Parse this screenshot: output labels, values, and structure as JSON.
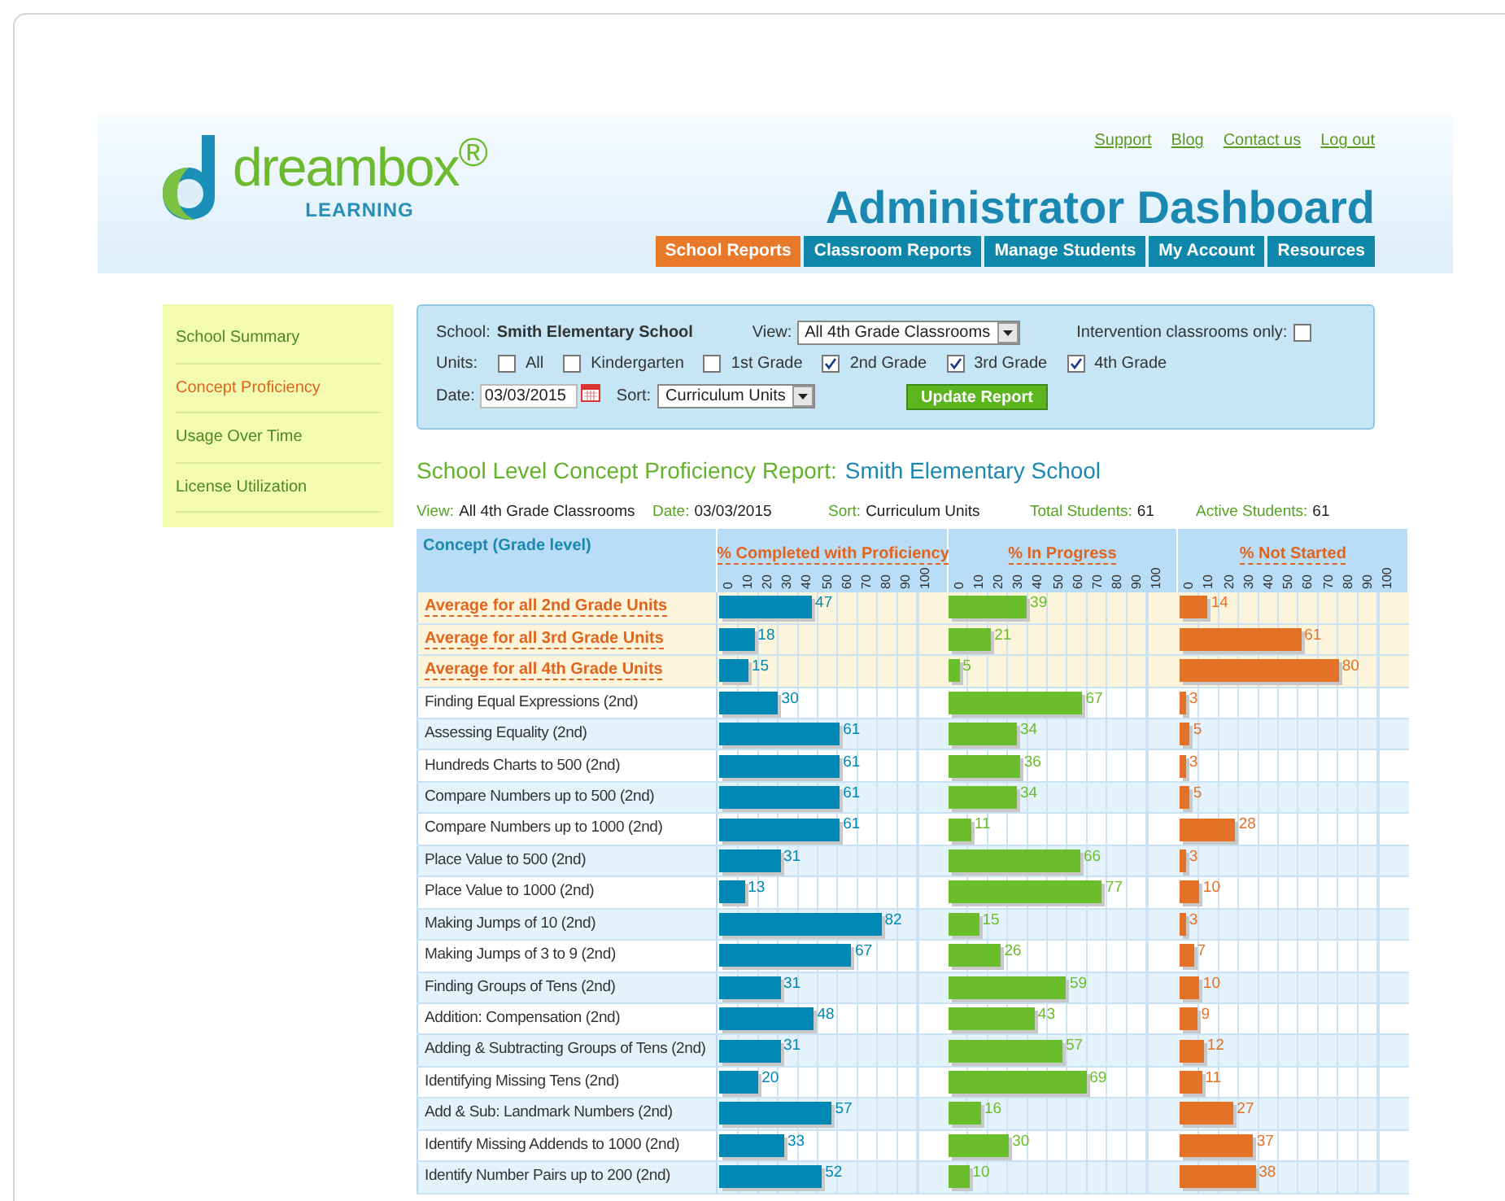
{
  "top_links": [
    "Support",
    "Blog",
    "Contact us",
    "Log out"
  ],
  "logo": {
    "name": "dreambox$^{®}$",
    "tagline": "LEARNING"
  },
  "page_title": "Administrator Dashboard",
  "tabs": [
    {
      "label": "School Reports",
      "selected": true
    },
    {
      "label": "Classroom Reports",
      "selected": false
    },
    {
      "label": "Manage Students",
      "selected": false
    },
    {
      "label": "My Account",
      "selected": false
    },
    {
      "label": "Resources",
      "selected": false
    }
  ],
  "sidebar": {
    "items": [
      {
        "label": "School Summary",
        "selected": false
      },
      {
        "label": "Concept Proficiency",
        "selected": true
      },
      {
        "label": "Usage Over Time",
        "selected": false
      },
      {
        "label": "License Utilization",
        "selected": false
      }
    ]
  },
  "filters": {
    "school_label": "School:",
    "school": "Smith Elementary School",
    "view_label": "View:",
    "view": "All 4th Grade Classrooms",
    "intervention_label": "Intervention classrooms only:",
    "intervention_checked": false,
    "units_label": "Units:",
    "units": [
      {
        "label": "All",
        "checked": false
      },
      {
        "label": "Kindergarten",
        "checked": false
      },
      {
        "label": "1st Grade",
        "checked": false
      },
      {
        "label": "2nd Grade",
        "checked": true
      },
      {
        "label": "3rd Grade",
        "checked": true
      },
      {
        "label": "4th Grade",
        "checked": true
      }
    ],
    "date_label": "Date:",
    "date": "03/03/2015",
    "sort_label": "Sort:",
    "sort": "Curriculum Units",
    "button": "Update Report"
  },
  "report_title": {
    "prefix": "School Level Concept Proficiency Report:",
    "school": "Smith Elementary School"
  },
  "summary": [
    {
      "label": "View:",
      "value": "All 4th Grade Classrooms"
    },
    {
      "label": "Date:",
      "value": "03/03/2015"
    },
    {
      "label": "Sort:",
      "value": "Curriculum Units"
    },
    {
      "label": "Total Students:",
      "value": "61"
    },
    {
      "label": "Active Students:",
      "value": "61"
    }
  ],
  "table": {
    "concept_header": "Concept (Grade level)",
    "bar_columns": [
      {
        "title": "% Completed with Proficiency",
        "color": "#0088b4",
        "ticks": [
          "0",
          "10",
          "20",
          "30",
          "40",
          "50",
          "60",
          "70",
          "80",
          "90",
          "100"
        ]
      },
      {
        "title": "% In Progress",
        "color": "#6abd2b",
        "ticks": [
          "0",
          "10",
          "20",
          "30",
          "40",
          "50",
          "60",
          "70",
          "80",
          "90",
          "100"
        ]
      },
      {
        "title": "% Not Started",
        "color": "#e37226",
        "ticks": [
          "0",
          "10",
          "20",
          "30",
          "40",
          "50",
          "60",
          "70",
          "80",
          "90",
          "100"
        ]
      }
    ],
    "rows": [
      {
        "kind": "average",
        "concept": "Average for all 2nd Grade Units",
        "bars": [
          {
            "reading": "47",
            "level": 0.47
          },
          {
            "reading": "39",
            "level": 0.39
          },
          {
            "reading": "14",
            "level": 0.14
          }
        ]
      },
      {
        "kind": "average",
        "concept": "Average for all 3rd Grade Units",
        "bars": [
          {
            "reading": "18",
            "level": 0.18
          },
          {
            "reading": "21",
            "level": 0.21
          },
          {
            "reading": "61",
            "level": 0.61
          }
        ]
      },
      {
        "kind": "average",
        "concept": "Average for all 4th Grade Units",
        "bars": [
          {
            "reading": "15",
            "level": 0.15
          },
          {
            "reading": "5",
            "level": 0.05
          },
          {
            "reading": "80",
            "level": 0.8
          }
        ]
      },
      {
        "kind": "unit",
        "concept": "Finding Equal Expressions (2nd)",
        "bars": [
          {
            "reading": "30",
            "level": 0.3
          },
          {
            "reading": "67",
            "level": 0.67
          },
          {
            "reading": "3",
            "level": 0.03
          }
        ]
      },
      {
        "kind": "unit",
        "concept": "Assessing Equality (2nd)",
        "bars": [
          {
            "reading": "61",
            "level": 0.61
          },
          {
            "reading": "34",
            "level": 0.34
          },
          {
            "reading": "5",
            "level": 0.05
          }
        ]
      },
      {
        "kind": "unit",
        "concept": "Hundreds Charts to 500 (2nd)",
        "bars": [
          {
            "reading": "61",
            "level": 0.61
          },
          {
            "reading": "36",
            "level": 0.36
          },
          {
            "reading": "3",
            "level": 0.03
          }
        ]
      },
      {
        "kind": "unit",
        "concept": "Compare Numbers up to 500 (2nd)",
        "bars": [
          {
            "reading": "61",
            "level": 0.61
          },
          {
            "reading": "34",
            "level": 0.34
          },
          {
            "reading": "5",
            "level": 0.05
          }
        ]
      },
      {
        "kind": "unit",
        "concept": "Compare Numbers up to 1000 (2nd)",
        "bars": [
          {
            "reading": "61",
            "level": 0.61
          },
          {
            "reading": "11",
            "level": 0.11
          },
          {
            "reading": "28",
            "level": 0.28
          }
        ]
      },
      {
        "kind": "unit",
        "concept": "Place Value to 500 (2nd)",
        "bars": [
          {
            "reading": "31",
            "level": 0.31
          },
          {
            "reading": "66",
            "level": 0.66
          },
          {
            "reading": "3",
            "level": 0.03
          }
        ]
      },
      {
        "kind": "unit",
        "concept": "Place Value to 1000 (2nd)",
        "bars": [
          {
            "reading": "13",
            "level": 0.13
          },
          {
            "reading": "77",
            "level": 0.77
          },
          {
            "reading": "10",
            "level": 0.1
          }
        ]
      },
      {
        "kind": "unit",
        "concept": "Making Jumps of 10 (2nd)",
        "bars": [
          {
            "reading": "82",
            "level": 0.82
          },
          {
            "reading": "15",
            "level": 0.15
          },
          {
            "reading": "3",
            "level": 0.03
          }
        ]
      },
      {
        "kind": "unit",
        "concept": "Making Jumps of 3 to 9 (2nd)",
        "bars": [
          {
            "reading": "67",
            "level": 0.67
          },
          {
            "reading": "26",
            "level": 0.26
          },
          {
            "reading": "7",
            "level": 0.07
          }
        ]
      },
      {
        "kind": "unit",
        "concept": "Finding Groups of Tens (2nd)",
        "bars": [
          {
            "reading": "31",
            "level": 0.31
          },
          {
            "reading": "59",
            "level": 0.59
          },
          {
            "reading": "10",
            "level": 0.1
          }
        ]
      },
      {
        "kind": "unit",
        "concept": "Addition: Compensation (2nd)",
        "bars": [
          {
            "reading": "48",
            "level": 0.48
          },
          {
            "reading": "43",
            "level": 0.43
          },
          {
            "reading": "9",
            "level": 0.09
          }
        ]
      },
      {
        "kind": "unit",
        "concept": "Adding & Subtracting Groups of Tens (2nd)",
        "bars": [
          {
            "reading": "31",
            "level": 0.31
          },
          {
            "reading": "57",
            "level": 0.57
          },
          {
            "reading": "12",
            "level": 0.12
          }
        ]
      },
      {
        "kind": "unit",
        "concept": "Identifying Missing Tens (2nd)",
        "bars": [
          {
            "reading": "20",
            "level": 0.2
          },
          {
            "reading": "69",
            "level": 0.69
          },
          {
            "reading": "11",
            "level": 0.11
          }
        ]
      },
      {
        "kind": "unit",
        "concept": "Add & Sub: Landmark Numbers (2nd)",
        "bars": [
          {
            "reading": "57",
            "level": 0.57
          },
          {
            "reading": "16",
            "level": 0.16
          },
          {
            "reading": "27",
            "level": 0.27
          }
        ]
      },
      {
        "kind": "unit",
        "concept": "Identify Missing Addends to 1000 (2nd)",
        "bars": [
          {
            "reading": "33",
            "level": 0.33
          },
          {
            "reading": "30",
            "level": 0.3
          },
          {
            "reading": "37",
            "level": 0.37
          }
        ]
      },
      {
        "kind": "unit",
        "concept": "Identify Number Pairs up to 200 (2nd)",
        "bars": [
          {
            "reading": "52",
            "level": 0.52
          },
          {
            "reading": "10",
            "level": 0.1
          },
          {
            "reading": "38",
            "level": 0.38
          }
        ]
      }
    ]
  }
}
